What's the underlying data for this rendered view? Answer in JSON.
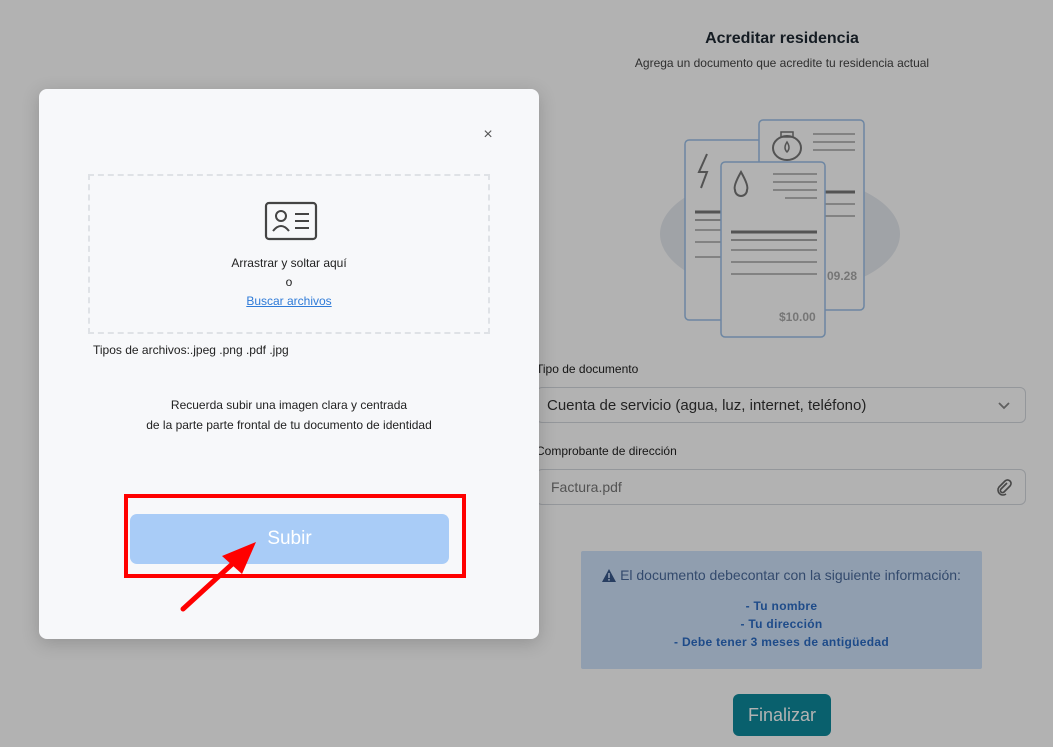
{
  "page": {
    "title": "Acreditar residencia",
    "subtitle": "Agrega un documento que acredite tu residencia actual",
    "illustration": {
      "amount_partial": "09.28",
      "amount": "$10.00"
    },
    "document_type": {
      "label": "Tipo de documento",
      "value": "Cuenta de servicio (agua, luz, internet, teléfono)"
    },
    "address_proof": {
      "label": "Comprobante de dirección",
      "value": "Factura.pdf"
    },
    "info": {
      "heading": "El documento debecontar con la siguiente información:",
      "items": [
        "- Tu nombre",
        "- Tu dirección",
        "- Debe tener 3 meses de antigüedad"
      ]
    },
    "finalize_label": "Finalizar"
  },
  "modal": {
    "close_symbol": "×",
    "dropzone": {
      "drag_text": "Arrastrar y soltar aquí",
      "or_text": "o",
      "browse_text": "Buscar archivos"
    },
    "file_types": "Tipos de archivos:.jpeg .png .pdf .jpg",
    "reminder_line1": "Recuerda subir una imagen clara y centrada",
    "reminder_line2": "de la parte parte frontal de tu documento de identidad",
    "upload_label": "Subir"
  },
  "colors": {
    "accent": "#0d8a9c",
    "upload_button": "#a9ccf7",
    "link": "#2f7bd8",
    "highlight": "#ff0000"
  },
  "icons": [
    "id-card-icon",
    "close-icon",
    "chevron-down-icon",
    "paperclip-icon",
    "warning-icon",
    "lightning-icon",
    "water-drop-icon",
    "gas-tank-icon"
  ]
}
